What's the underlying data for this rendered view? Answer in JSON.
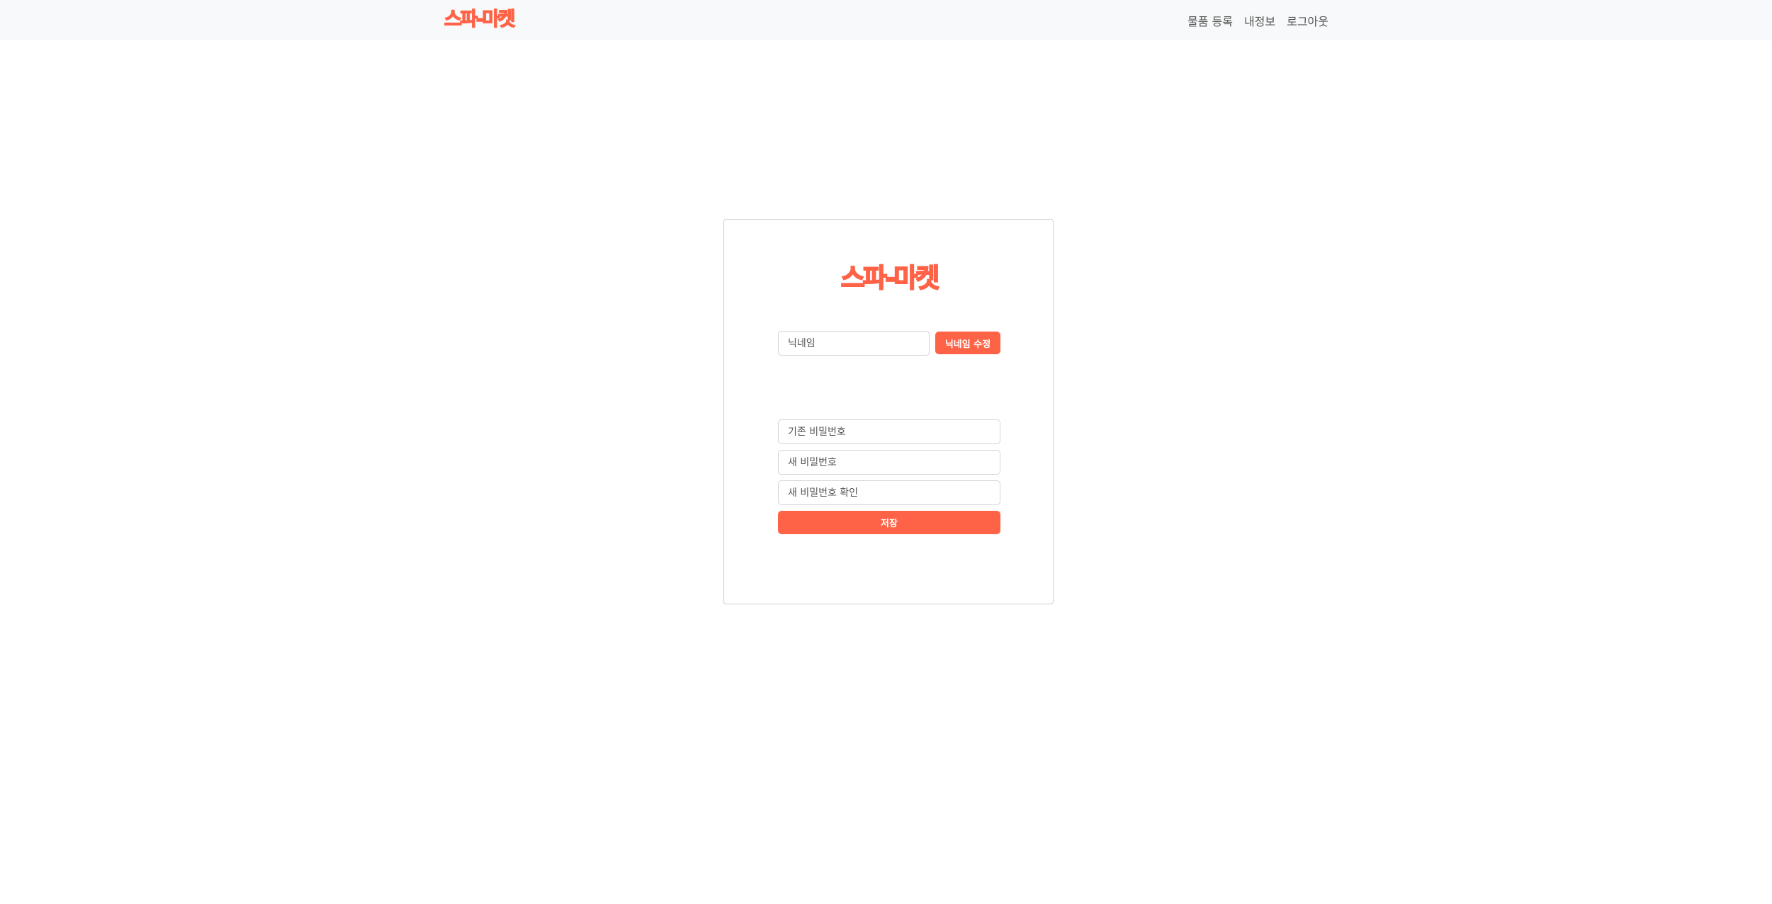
{
  "header": {
    "brand": "스파-마켓",
    "nav": [
      {
        "label": "물품 등록"
      },
      {
        "label": "내정보"
      },
      {
        "label": "로그아웃"
      }
    ]
  },
  "profile_card": {
    "logo": "스파-마켓",
    "nickname": {
      "placeholder": "닉네임",
      "value": "",
      "button_label": "닉네임 수정"
    },
    "password": {
      "current_placeholder": "기존 비밀번호",
      "new_placeholder": "새 비밀번호",
      "confirm_placeholder": "새 비밀번호 확인",
      "save_label": "저장"
    }
  },
  "colors": {
    "accent": "#ff6347",
    "navbar_bg": "#f8f9fa"
  }
}
